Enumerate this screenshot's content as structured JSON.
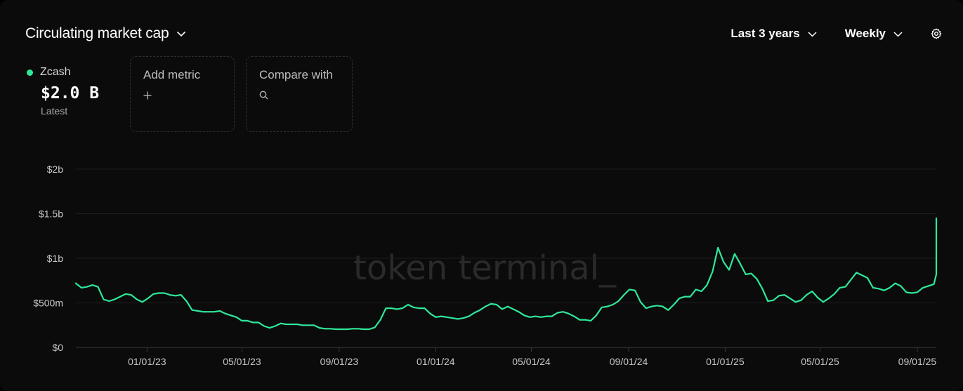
{
  "header": {
    "title": "Circulating market cap",
    "range_label": "Last 3 years",
    "interval_label": "Weekly"
  },
  "metric": {
    "name": "Zcash",
    "value": "$2.0 B",
    "sub": "Latest",
    "color": "#2ee89a"
  },
  "tiles": {
    "add_metric": "Add metric",
    "compare_with": "Compare with"
  },
  "watermark": "token terminal_",
  "chart_data": {
    "type": "line",
    "title": "",
    "xlabel": "",
    "ylabel": "",
    "ylim": [
      0,
      2000000000
    ],
    "yticks": [
      0,
      500000000,
      1000000000,
      1500000000,
      2000000000
    ],
    "ytick_labels": [
      "$0",
      "$500m",
      "$1b",
      "$1.5b",
      "$2b"
    ],
    "xtick_dates": [
      "2023-01-01",
      "2023-05-01",
      "2023-09-01",
      "2024-01-01",
      "2024-05-01",
      "2024-09-01",
      "2025-01-01",
      "2025-05-01",
      "2025-09-01"
    ],
    "xtick_labels": [
      "01/01/23",
      "05/01/23",
      "09/01/23",
      "01/01/24",
      "05/01/24",
      "09/01/24",
      "01/01/25",
      "05/01/25",
      "09/01/25"
    ],
    "xlim": [
      "2022-10-03",
      "2025-09-25"
    ],
    "grid": "horizontal",
    "series": [
      {
        "name": "Zcash",
        "color": "#2ee89a",
        "x_start": "2022-10-03",
        "step_days": 7,
        "values": [
          720,
          670,
          680,
          700,
          680,
          540,
          520,
          540,
          570,
          600,
          590,
          540,
          510,
          550,
          600,
          610,
          610,
          590,
          580,
          590,
          520,
          420,
          410,
          400,
          400,
          400,
          410,
          380,
          360,
          340,
          300,
          300,
          280,
          280,
          240,
          220,
          240,
          270,
          260,
          260,
          260,
          250,
          250,
          250,
          220,
          210,
          210,
          205,
          205,
          205,
          210,
          210,
          205,
          205,
          225,
          310,
          440,
          440,
          430,
          440,
          480,
          450,
          440,
          440,
          380,
          340,
          350,
          340,
          330,
          320,
          330,
          350,
          390,
          420,
          460,
          490,
          480,
          430,
          460,
          430,
          400,
          360,
          340,
          350,
          340,
          350,
          350,
          390,
          400,
          380,
          350,
          310,
          310,
          300,
          360,
          450,
          460,
          480,
          520,
          590,
          650,
          640,
          510,
          440,
          460,
          470,
          460,
          420,
          480,
          550,
          570,
          570,
          650,
          630,
          700,
          850,
          1120,
          960,
          870,
          1050,
          940,
          820,
          830,
          770,
          660,
          520,
          530,
          580,
          590,
          550,
          510,
          530,
          590,
          630,
          560,
          510,
          550,
          600,
          670,
          680,
          760,
          840,
          810,
          780,
          670,
          660,
          640,
          670,
          720,
          690,
          620,
          610,
          620,
          670,
          690,
          710,
          820,
          830,
          910,
          1450
        ]
      }
    ]
  }
}
